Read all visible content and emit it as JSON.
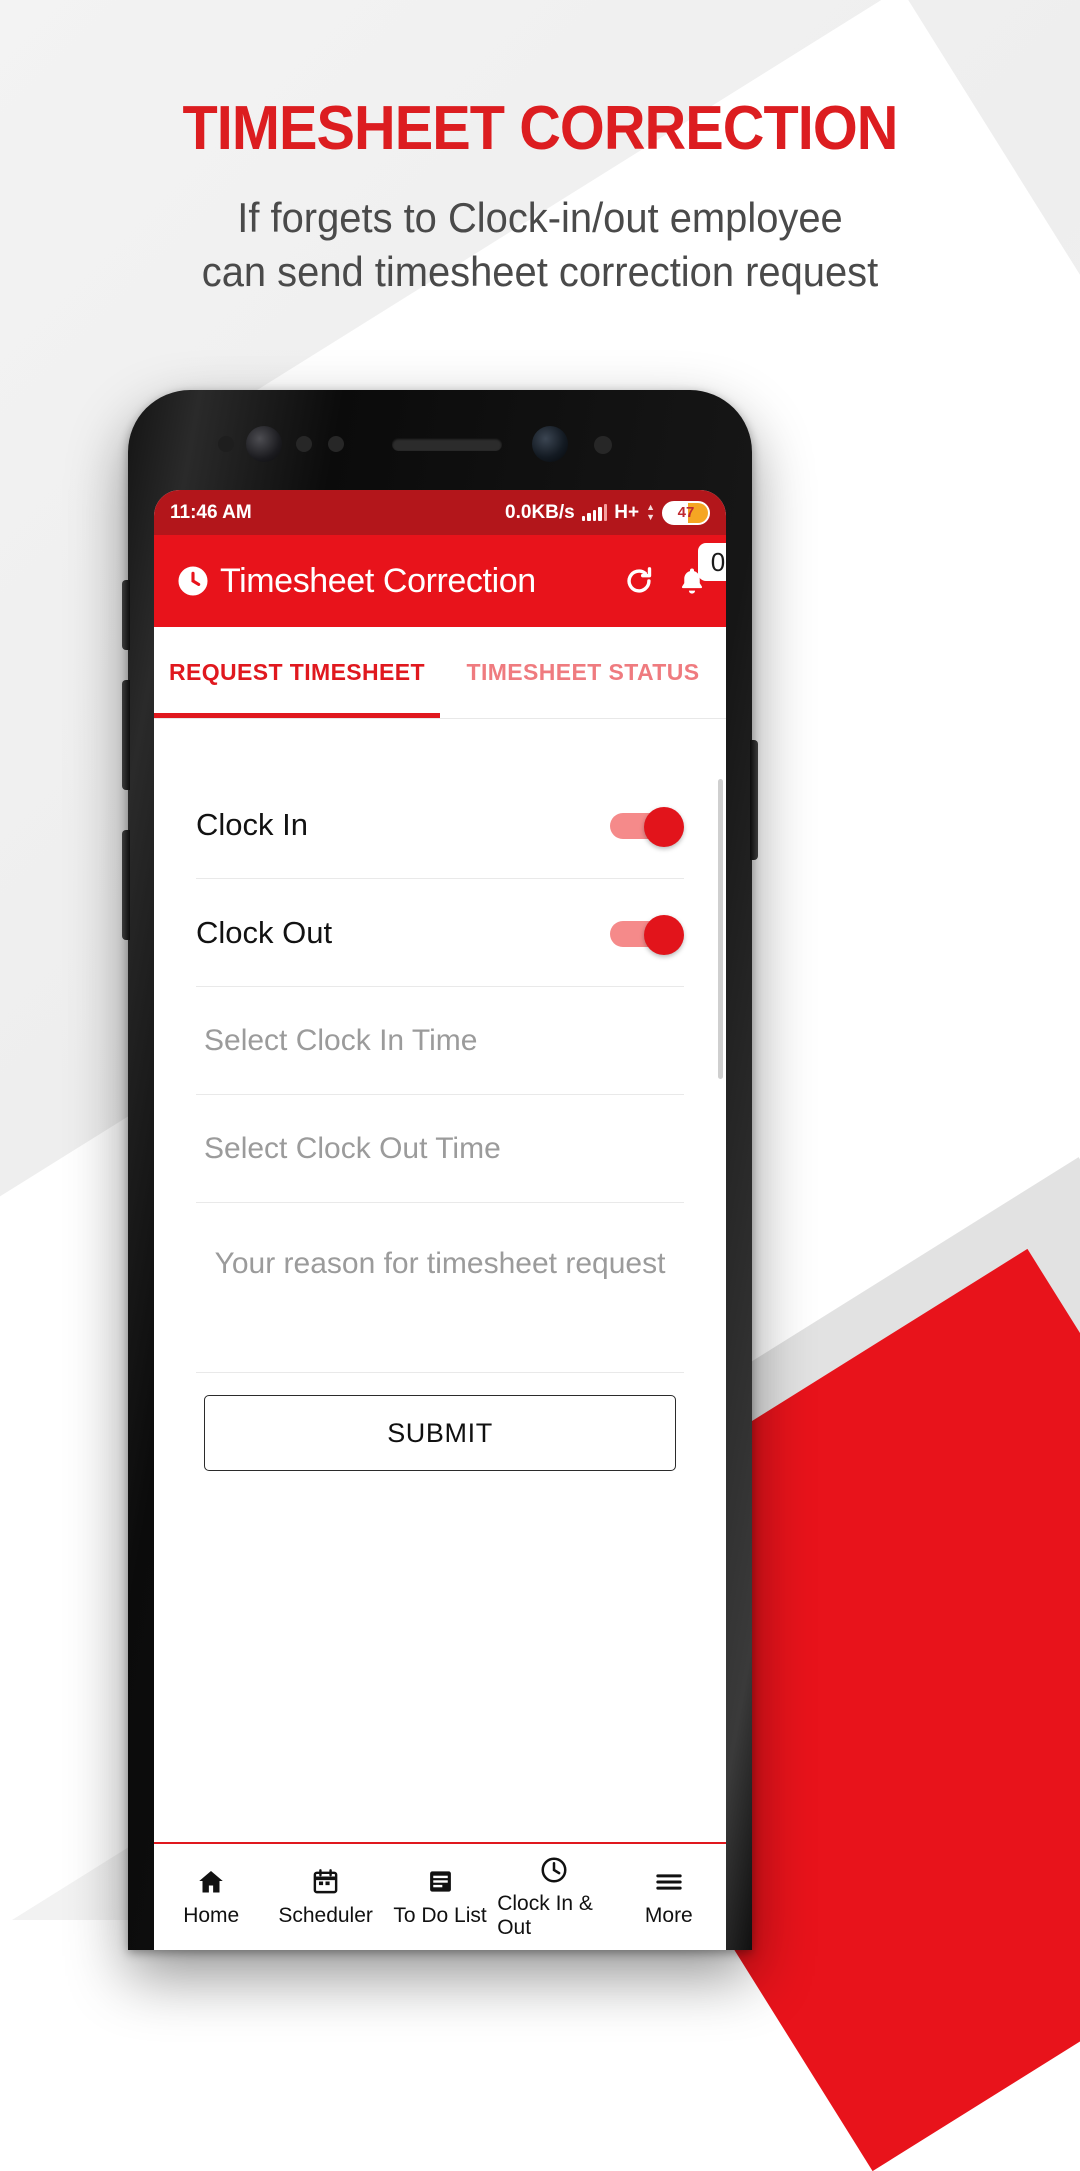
{
  "promo": {
    "title": "TIMESHEET CORRECTION",
    "subtitle_line1": "If forgets to Clock-in/out employee",
    "subtitle_line2": "can send timesheet correction request",
    "title_color": "#dc1d20",
    "subtitle_color": "#4a4a4a"
  },
  "statusbar": {
    "time": "11:46 AM",
    "network_speed": "0.0KB/s",
    "network_type": "H+",
    "battery_level": "47",
    "signal_icon": "signal-bars-icon",
    "background": "#b3161b"
  },
  "appbar": {
    "title": "Timesheet Correction",
    "clock_icon": "clock-icon",
    "refresh_icon": "refresh-icon",
    "bell_icon": "bell-icon",
    "notification_count": "0",
    "background": "#e8131b"
  },
  "tabs": [
    {
      "label": "REQUEST TIMESHEET",
      "active": true
    },
    {
      "label": "TIMESHEET STATUS",
      "active": false
    }
  ],
  "form": {
    "toggles": [
      {
        "label": "Clock In",
        "state": "on"
      },
      {
        "label": "Clock Out",
        "state": "on"
      }
    ],
    "fields": [
      {
        "placeholder": "Select Clock In Time",
        "value": ""
      },
      {
        "placeholder": "Select Clock Out Time",
        "value": ""
      }
    ],
    "reason": {
      "placeholder": "Your reason for timesheet request",
      "value": ""
    },
    "submit_label": "SUBMIT"
  },
  "bottom_nav": [
    {
      "label": "Home",
      "icon": "home-icon"
    },
    {
      "label": "Scheduler",
      "icon": "calendar-icon"
    },
    {
      "label": "To Do List",
      "icon": "list-icon"
    },
    {
      "label": "Clock In & Out",
      "icon": "clock-icon"
    },
    {
      "label": "More",
      "icon": "hamburger-icon"
    }
  ]
}
